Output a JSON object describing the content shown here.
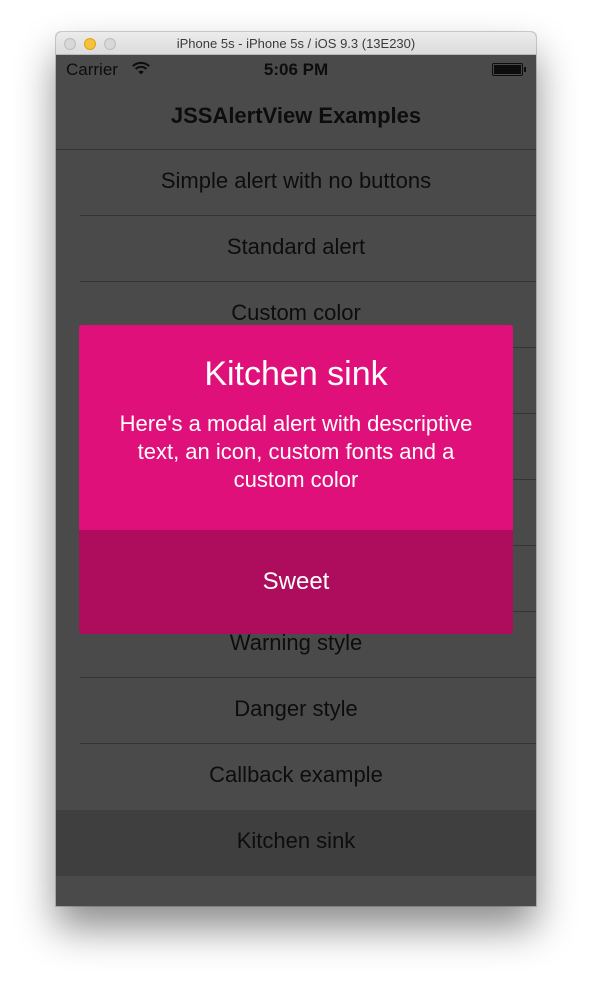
{
  "window": {
    "title": "iPhone 5s - iPhone 5s / iOS 9.3 (13E230)"
  },
  "statusbar": {
    "carrier": "Carrier",
    "time": "5:06 PM",
    "wifi_icon": "wifi-icon",
    "battery_icon": "battery-icon"
  },
  "nav": {
    "title": "JSSAlertView Examples"
  },
  "list": {
    "items": [
      {
        "label": "Simple alert with no buttons"
      },
      {
        "label": "Standard alert"
      },
      {
        "label": "Custom color"
      },
      {
        "label": ""
      },
      {
        "label": ""
      },
      {
        "label": ""
      },
      {
        "label": ""
      },
      {
        "label": "Warning style"
      },
      {
        "label": "Danger style"
      },
      {
        "label": "Callback example"
      },
      {
        "label": "Kitchen sink"
      }
    ]
  },
  "alert": {
    "title": "Kitchen sink",
    "message": "Here's a modal alert with descriptive text, an icon, custom fonts and a custom color",
    "button_label": "Sweet"
  },
  "colors": {
    "alert_background": "#e0107a",
    "alert_button": "#ad0d5c",
    "screen_background": "#4a4a4a",
    "selected_row": "#3f3f3f"
  }
}
